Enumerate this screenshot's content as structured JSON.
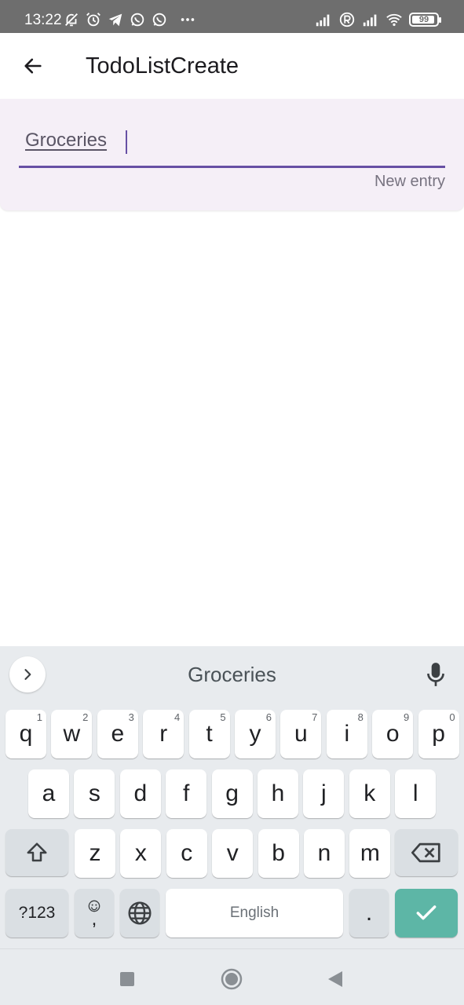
{
  "status_bar": {
    "time": "13:22",
    "left_icons": [
      "bell-off-icon",
      "alarm-icon",
      "telegram-icon",
      "whatsapp-icon",
      "whatsapp-icon",
      "more-dots-icon"
    ],
    "right_icons": [
      "signal-icon",
      "roaming-icon",
      "signal-icon",
      "wifi-icon"
    ],
    "battery": "99"
  },
  "app_bar": {
    "title": "TodoListCreate",
    "back_icon": "arrow-back-icon"
  },
  "form": {
    "input_value": "Groceries",
    "helper_text": "New entry",
    "accent_color": "#6750a4"
  },
  "keyboard": {
    "suggestion": "Groceries",
    "row1": [
      {
        "k": "q",
        "h": "1"
      },
      {
        "k": "w",
        "h": "2"
      },
      {
        "k": "e",
        "h": "3"
      },
      {
        "k": "r",
        "h": "4"
      },
      {
        "k": "t",
        "h": "5"
      },
      {
        "k": "y",
        "h": "6"
      },
      {
        "k": "u",
        "h": "7"
      },
      {
        "k": "i",
        "h": "8"
      },
      {
        "k": "o",
        "h": "9"
      },
      {
        "k": "p",
        "h": "0"
      }
    ],
    "row2": [
      "a",
      "s",
      "d",
      "f",
      "g",
      "h",
      "j",
      "k",
      "l"
    ],
    "row3": [
      "z",
      "x",
      "c",
      "v",
      "b",
      "n",
      "m"
    ],
    "symbols_label": "?123",
    "comma": ",",
    "space_label": "English",
    "period": ".",
    "enter_color": "#5db6a6"
  },
  "nav_bar": {
    "buttons": [
      "recents-square-icon",
      "home-circle-icon",
      "back-triangle-icon"
    ]
  }
}
